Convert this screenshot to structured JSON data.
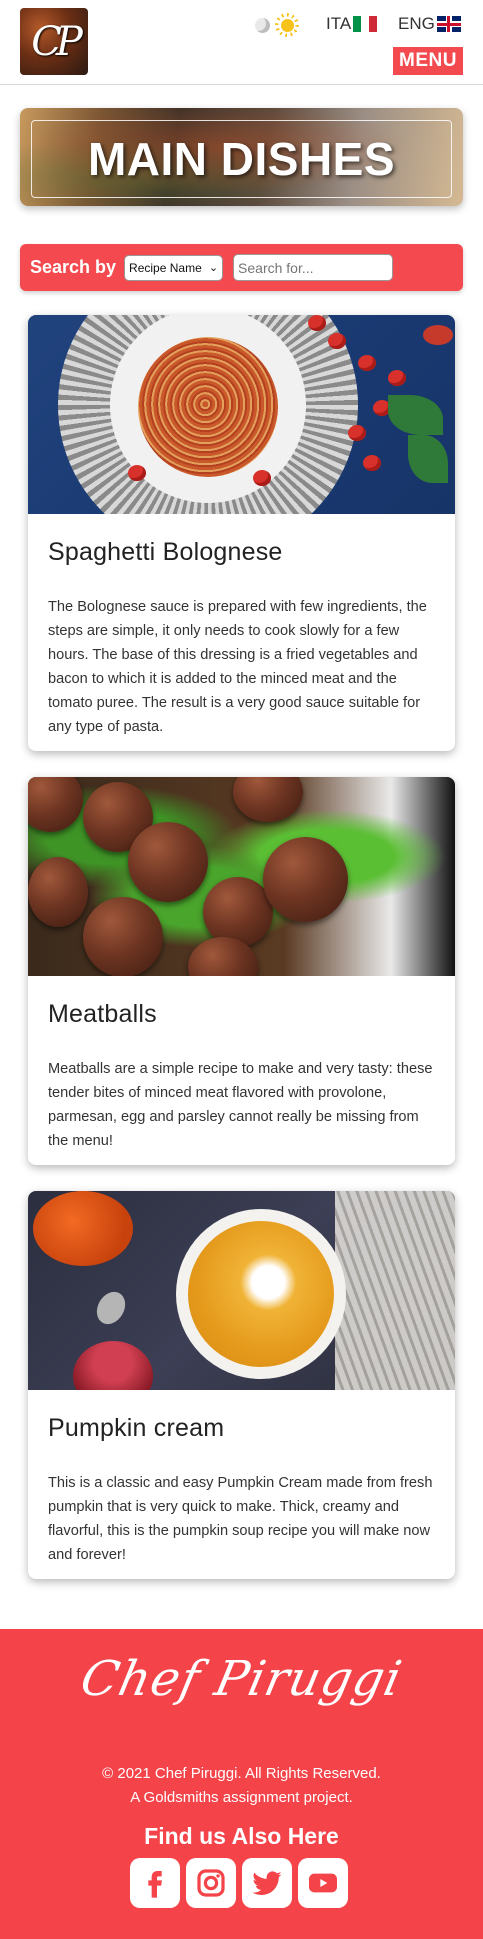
{
  "header": {
    "logo_text": "CP",
    "lang_ita": "ITA",
    "lang_eng": "ENG",
    "menu_label": "MENU"
  },
  "hero": {
    "title": "MAIN DISHES"
  },
  "search": {
    "label": "Search by",
    "select_value": "Recipe Name",
    "placeholder": "Search for..."
  },
  "recipes": [
    {
      "title": "Spaghetti Bolognese",
      "description": "The Bolognese sauce is prepared with few ingredients, the steps are simple, it only needs to cook slowly for a few hours. The base of this dressing is a fried vegetables and bacon to which it is added to the minced meat and the tomato puree. The result is a very good sauce suitable for any type of pasta."
    },
    {
      "title": "Meatballs",
      "description": "Meatballs are a simple recipe to make and very tasty: these tender bites of minced meat flavored with provolone, parmesan, egg and parsley cannot really be missing from the menu!"
    },
    {
      "title": "Pumpkin cream",
      "description": "This is a classic and easy Pumpkin Cream made from fresh pumpkin that is very quick to make. Thick, creamy and flavorful, this is the pumpkin soup recipe you will make now and forever!"
    }
  ],
  "footer": {
    "signature": "Chef Piruggi",
    "copyright_line1": "© 2021 Chef Piruggi. All Rights Reserved.",
    "copyright_line2": "A Goldsmiths assignment project.",
    "find_us": "Find us Also Here",
    "socials": [
      "facebook-icon",
      "instagram-icon",
      "twitter-icon",
      "youtube-icon"
    ]
  },
  "colors": {
    "accent": "#f44a4f",
    "footer_bg": "#f44349"
  }
}
